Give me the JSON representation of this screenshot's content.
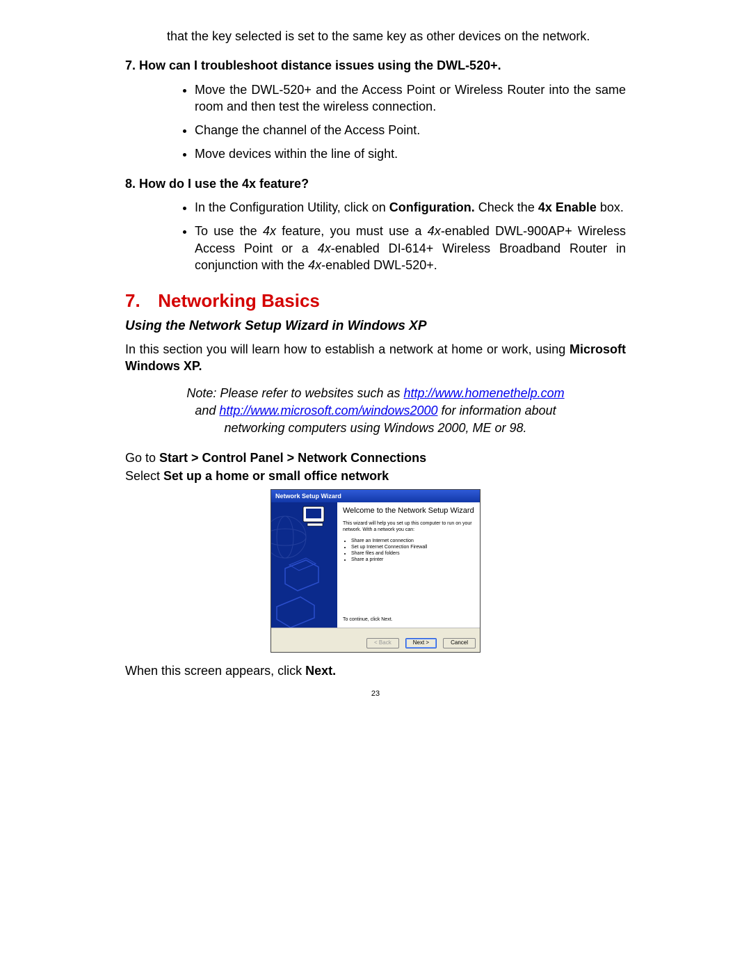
{
  "prev_para": "that the key selected is set to the same key as other devices on the network.",
  "q7": {
    "heading": "7.  How can I troubleshoot distance issues using the DWL-520+.",
    "bullets": [
      "Move the DWL-520+ and the Access Point or Wireless Router into the same room and then test the wireless connection.",
      "Change the channel of the Access Point.",
      "Move devices within the line of sight."
    ]
  },
  "q8": {
    "heading": "8. How do I use the 4x feature?",
    "bullets_html": [
      "In the Configuration Utility, click on <b>Configuration.</b> Check the <b>4x Enable</b> box.",
      "To use the <i>4x</i> feature, you must use a <i>4x</i>-enabled DWL-900AP+ Wireless Access Point or a <i>4x</i>-enabled DI-614+ Wireless Broadband Router in conjunction with the <i>4x</i>-enabled DWL-520+."
    ]
  },
  "section": {
    "num": "7.",
    "title": "Networking Basics",
    "subhead": "Using the Network Setup Wizard in Windows XP",
    "intro_pre": "In this section you will learn how to establish a network at home or work, using ",
    "intro_bold": "Microsoft Windows XP.",
    "note": {
      "l1a": "Note:  Please refer to websites such as ",
      "link1": "http://www.homenethelp.com",
      "l2a": "and ",
      "link2": "http://www.microsoft.com/windows2000",
      "l2b": "  for information about",
      "l3": "networking computers using Windows 2000, ME or 98."
    },
    "goto_pre": "Go to ",
    "goto_bold": "Start > Control Panel > Network Connections",
    "select_pre": "Select ",
    "select_bold": "Set up a home or small office network"
  },
  "wizard": {
    "title": "Network Setup Wizard",
    "heading": "Welcome to the Network Setup Wizard",
    "desc": "This wizard will help you set up this computer to run on your network. With a network you can:",
    "items": [
      "Share an Internet connection",
      "Set up Internet Connection Firewall",
      "Share files and folders",
      "Share a printer"
    ],
    "cont": "To continue, click Next.",
    "back": "< Back",
    "next": "Next >",
    "cancel": "Cancel"
  },
  "after": {
    "pre": "When this screen appears, click ",
    "bold": "Next."
  },
  "pagenum": "23"
}
